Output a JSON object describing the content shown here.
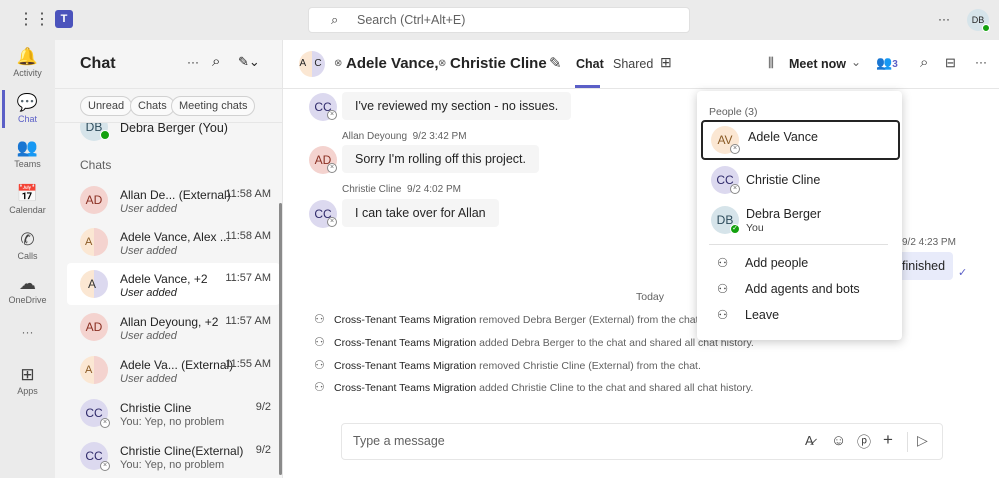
{
  "topbar": {
    "search_placeholder": "Search (Ctrl+Alt+E)",
    "more": "···",
    "user_initials": "DB"
  },
  "rail": [
    {
      "label": "Activity",
      "icon": "bell-icon",
      "glyph": "🔔"
    },
    {
      "label": "Chat",
      "icon": "chat-icon",
      "glyph": "💬"
    },
    {
      "label": "Teams",
      "icon": "teams-icon",
      "glyph": "👥"
    },
    {
      "label": "Calendar",
      "icon": "calendar-icon",
      "glyph": "📅"
    },
    {
      "label": "Calls",
      "icon": "phone-icon",
      "glyph": "✆"
    },
    {
      "label": "OneDrive",
      "icon": "cloud-icon",
      "glyph": "☁"
    },
    {
      "label": "Apps",
      "icon": "apps-icon",
      "glyph": "⊞"
    }
  ],
  "rail_more": "···",
  "chatlist": {
    "title": "Chat",
    "filters": [
      "Unread",
      "Chats",
      "Meeting chats"
    ],
    "pinned": {
      "initials": "DB",
      "name": "Debra Berger (You)"
    },
    "section": "Chats",
    "items": [
      {
        "initials": "AD",
        "name": "Allan De... (External)",
        "sub": "User added",
        "time": "11:58 AM"
      },
      {
        "initials": "A",
        "name": "Adele Vance, Alex ...",
        "sub": "User added",
        "time": "11:58 AM"
      },
      {
        "initials": "A C",
        "name": "Adele Vance, +2",
        "sub": "User added",
        "time": "11:57 AM"
      },
      {
        "initials": "AD",
        "name": "Allan Deyoung, +2",
        "sub": "User added",
        "time": "11:57 AM"
      },
      {
        "initials": "A",
        "name": "Adele Va... (External)",
        "sub": "User added",
        "time": "11:55 AM"
      },
      {
        "initials": "CC",
        "name": "Christie Cline",
        "sub": "You: Yep, no problem",
        "time": "9/2"
      },
      {
        "initials": "CC",
        "name": "Christie Cline(External)",
        "sub": "You: Yep, no problem",
        "time": "9/2"
      }
    ]
  },
  "header": {
    "title_a": "Adele Vance,",
    "title_b": "Christie Cline",
    "tabs": [
      "Chat",
      "Shared"
    ],
    "meet_now": "Meet now",
    "people_count": "3",
    "accent": "#5b5fc7"
  },
  "messages": [
    {
      "initials": "CC",
      "text": "I've reviewed my section - no issues."
    },
    {
      "author": "Allan Deyoung",
      "time": "9/2 3:42 PM",
      "initials": "AD",
      "text": "Sorry I'm rolling off this project."
    },
    {
      "author": "Christie Cline",
      "time": "9/2 4:02 PM",
      "initials": "CC",
      "text": "I can take over for Allan"
    }
  ],
  "own_message": {
    "time": "9/2 4:23 PM",
    "text": "finished"
  },
  "divider": "Today",
  "system": [
    {
      "actor": "Cross-Tenant Teams Migration",
      "text": "removed Debra Berger (External) from the chat."
    },
    {
      "actor": "Cross-Tenant Teams Migration",
      "text": "added Debra Berger to the chat and shared all chat history."
    },
    {
      "actor": "Cross-Tenant Teams Migration",
      "text": "removed Christie Cline (External) from the chat."
    },
    {
      "actor": "Cross-Tenant Teams Migration",
      "text": "added Christie Cline to the chat and shared all chat history."
    }
  ],
  "popup": {
    "title": "People (3)",
    "people": [
      {
        "initials": "AV",
        "name": "Adele Vance"
      },
      {
        "initials": "CC",
        "name": "Christie Cline"
      },
      {
        "initials": "DB",
        "name": "Debra Berger",
        "sub": "You"
      }
    ],
    "actions": [
      "Add people",
      "Add agents and bots",
      "Leave"
    ]
  },
  "compose": {
    "placeholder": "Type a message"
  }
}
